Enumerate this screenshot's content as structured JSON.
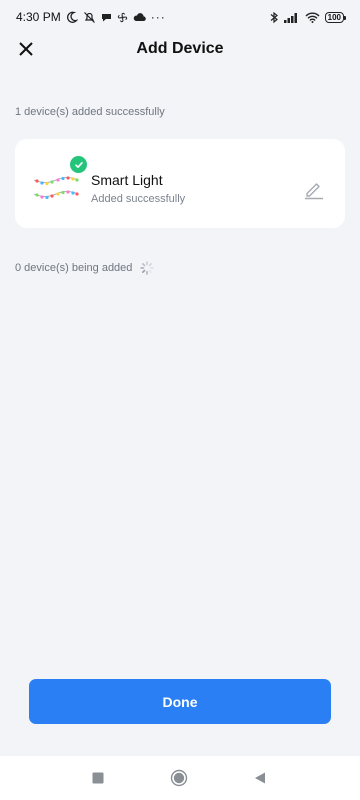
{
  "status_bar": {
    "time": "4:30 PM",
    "battery": "100",
    "left_icons": [
      "moon-icon",
      "notification-off-icon",
      "chat-icon",
      "fan-icon",
      "cloud-icon",
      "more-dots-icon"
    ],
    "right_icons": [
      "bluetooth-icon",
      "signal-icon",
      "wifi-icon",
      "battery-icon"
    ],
    "more": "···"
  },
  "header": {
    "title": "Add Device",
    "close_icon": "close-icon"
  },
  "added_section": {
    "label": "1 device(s) added successfully"
  },
  "devices": [
    {
      "name": "Smart Light",
      "status": "Added successfully",
      "status_icon": "check-icon",
      "edit_icon": "edit-pencil-icon"
    }
  ],
  "pending_section": {
    "label": "0 device(s) being added",
    "icon": "loading-spinner-icon"
  },
  "footer": {
    "done_label": "Done"
  },
  "nav": {
    "icons": [
      "recent-apps-icon",
      "home-icon",
      "back-icon"
    ]
  },
  "colors": {
    "accent": "#2a7ff5",
    "success": "#24c47a",
    "background": "#f3f4f8"
  }
}
